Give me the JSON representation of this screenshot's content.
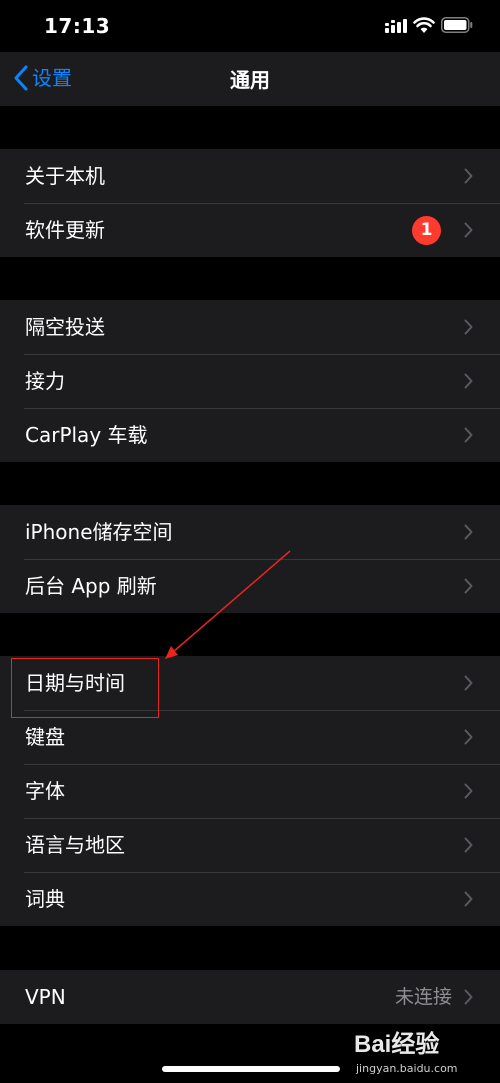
{
  "status_bar": {
    "time": "17:13"
  },
  "nav": {
    "back_label": "设置",
    "title": "通用"
  },
  "groups": [
    {
      "items": [
        {
          "label": "关于本机"
        },
        {
          "label": "软件更新",
          "badge": "1"
        }
      ]
    },
    {
      "items": [
        {
          "label": "隔空投送"
        },
        {
          "label": "接力"
        },
        {
          "label": "CarPlay 车载"
        }
      ]
    },
    {
      "items": [
        {
          "label": "iPhone储存空间"
        },
        {
          "label": "后台 App 刷新"
        }
      ]
    },
    {
      "items": [
        {
          "label": "日期与时间"
        },
        {
          "label": "键盘"
        },
        {
          "label": "字体"
        },
        {
          "label": "语言与地区"
        },
        {
          "label": "词典"
        }
      ]
    },
    {
      "items": [
        {
          "label": "VPN",
          "value": "未连接"
        }
      ]
    }
  ],
  "colors": {
    "accent": "#0a84ff",
    "badge": "#ff3b30",
    "annotation": "#e8251e",
    "background": "#000000",
    "cell": "#1c1c1e"
  },
  "watermark": {
    "logo_text": "Bai经验",
    "url": "jingyan.baidu.com"
  }
}
